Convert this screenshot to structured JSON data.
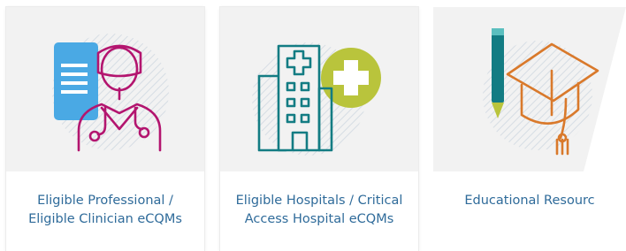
{
  "cards": [
    {
      "title": "Eligible Professional / Eligible Clinician eCQMs",
      "icon": "doctor-clipboard-icon"
    },
    {
      "title": "Eligible Hospitals / Critical Access Hospital eCQMs",
      "icon": "hospital-building-icon"
    },
    {
      "title": "Educational Resourc",
      "icon": "graduation-cap-pencil-icon"
    }
  ],
  "colors": {
    "card_art_bg": "#f2f2f2",
    "label_text": "#2f6b9a",
    "magenta": "#b3156f",
    "blue": "#4aa9e4",
    "teal": "#137c83",
    "olive": "#b9c43c",
    "orange": "#d9792b"
  }
}
